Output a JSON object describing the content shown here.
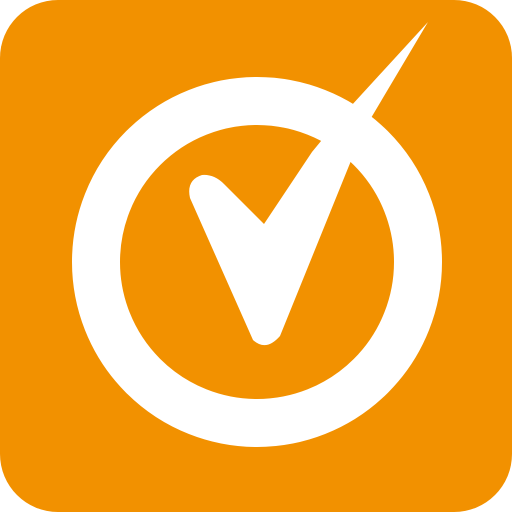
{
  "icon": {
    "name": "check-circle-icon",
    "background_color": "#F29100",
    "foreground_color": "#FFFFFF"
  }
}
